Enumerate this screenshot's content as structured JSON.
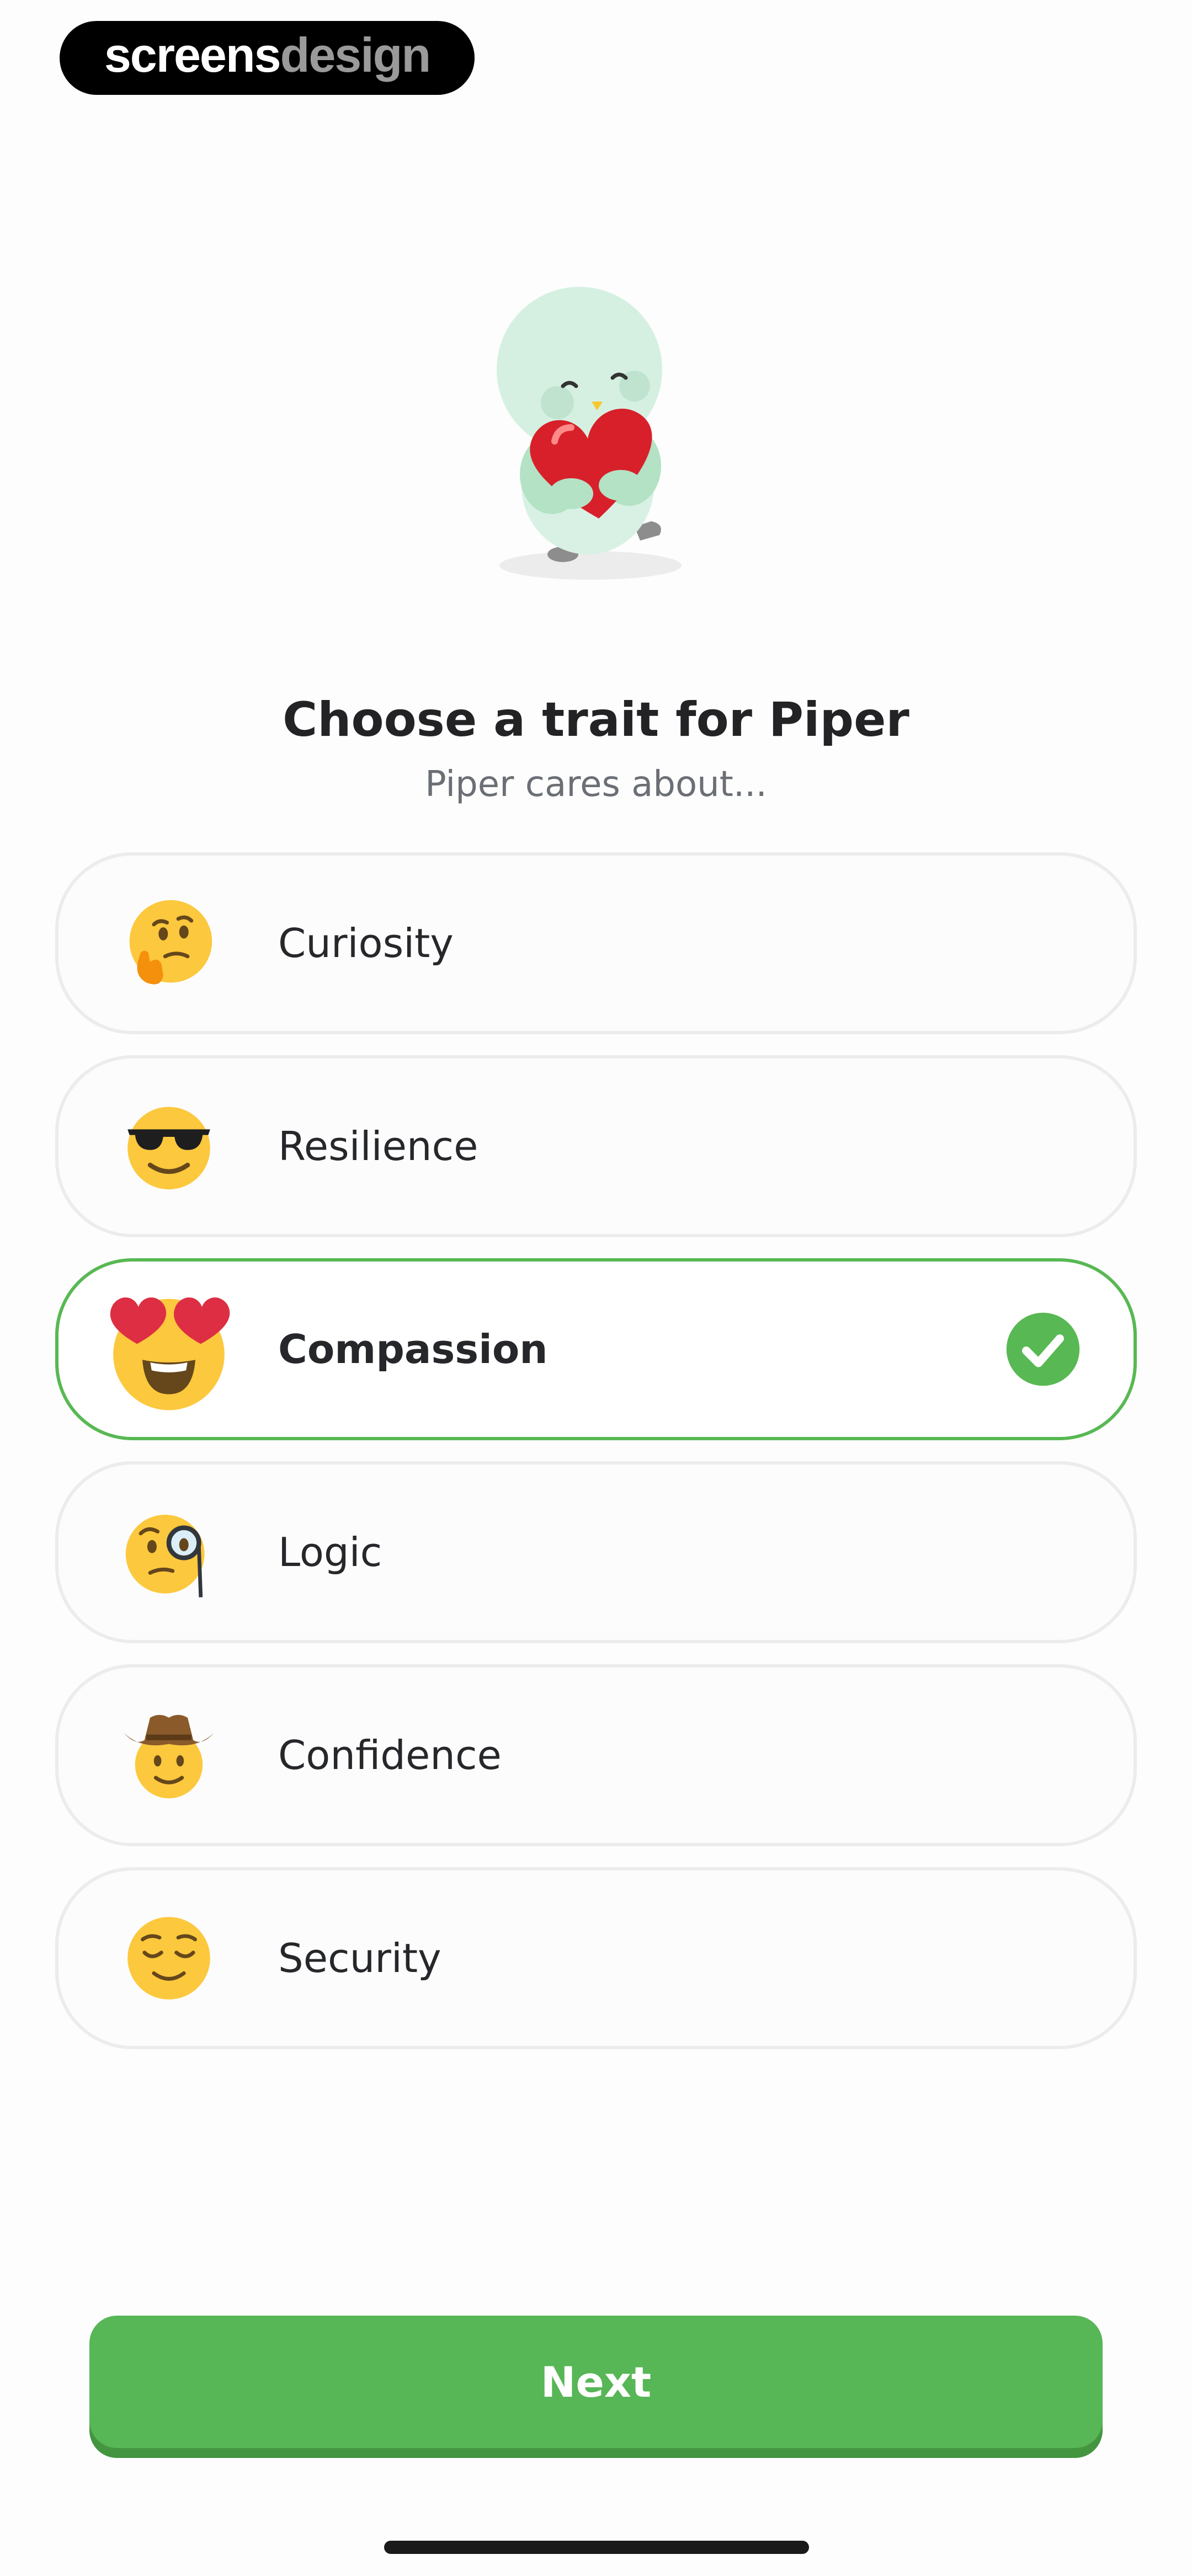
{
  "watermark": {
    "part1": "screens",
    "part2": "design"
  },
  "header": {
    "title": "Choose a trait for Piper",
    "subtitle": "Piper cares about..."
  },
  "options": [
    {
      "label": "Curiosity",
      "icon": "thinking-face-icon",
      "selected": false
    },
    {
      "label": "Resilience",
      "icon": "sunglasses-face-icon",
      "selected": false
    },
    {
      "label": "Compassion",
      "icon": "heart-eyes-face-icon",
      "selected": true
    },
    {
      "label": "Logic",
      "icon": "monocle-face-icon",
      "selected": false
    },
    {
      "label": "Confidence",
      "icon": "cowboy-face-icon",
      "selected": false
    },
    {
      "label": "Security",
      "icon": "relieved-face-icon",
      "selected": false
    }
  ],
  "next_button": {
    "label": "Next"
  },
  "colors": {
    "accent": "#57b655",
    "selected_border": "#58b853",
    "option_border": "#ececec",
    "emoji_yellow": "#fcc83d"
  }
}
